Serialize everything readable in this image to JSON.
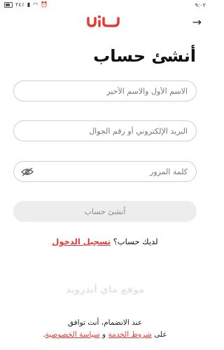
{
  "status_bar": {
    "time": "٩:٠٢",
    "battery": "٢٤٪"
  },
  "header": {
    "logo_icon": "brand-logo",
    "back_icon": "arrow-right-icon"
  },
  "title": "أنشئ حساب",
  "form": {
    "name_placeholder": "الاسم الأول والاسم الأخير",
    "contact_placeholder": "البريد الإلكتروني أو رقم الجوال",
    "password_placeholder": "كلمة المرور",
    "eye_icon": "eye-off-icon",
    "submit_label": "أنشئ حساب"
  },
  "login": {
    "prompt": "لديك حساب؟ ",
    "link": "تسجيل الدخول"
  },
  "watermark": "موقع ماي أندرويد",
  "terms": {
    "line1": "عند الانضمام، أنت توافق",
    "prefix": "على ",
    "terms_link": "شروط الخدمة",
    "conjunction": " و ",
    "privacy_link": "سياسة الخصوصية",
    "suffix": "."
  },
  "colors": {
    "accent": "#e53935",
    "field_border": "#d0d0d0",
    "button_disabled": "#ededed"
  }
}
